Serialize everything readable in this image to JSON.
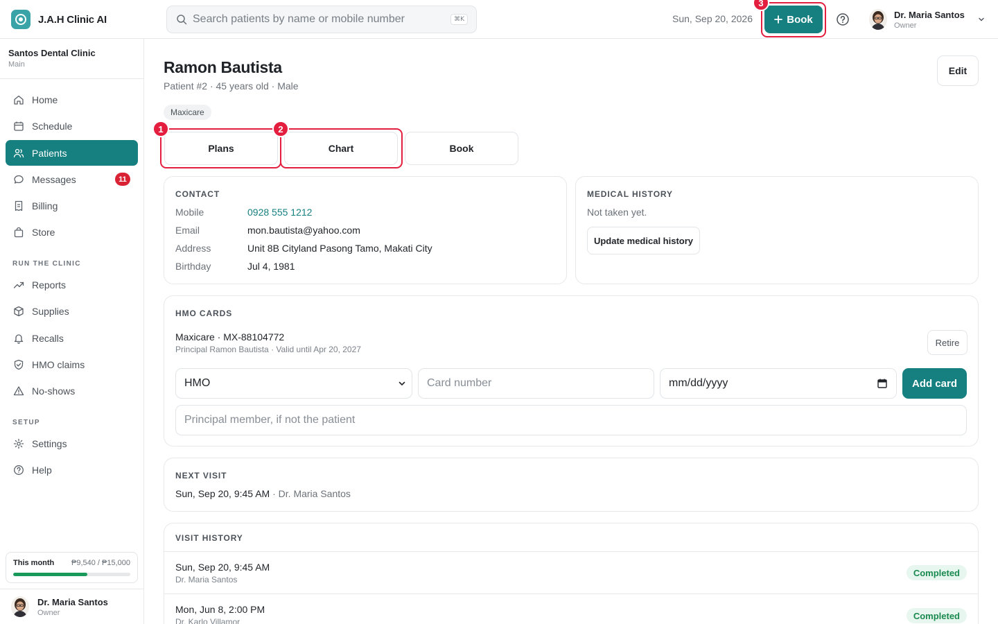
{
  "app": {
    "name": "J.A.H Clinic AI"
  },
  "search": {
    "placeholder": "Search patients by name or mobile number",
    "shortcut": "⌘K"
  },
  "top": {
    "date": "Sun, Sep 20, 2026",
    "book_label": "Book",
    "user": {
      "name": "Dr. Maria Santos",
      "role": "Owner"
    }
  },
  "annotations": {
    "one": "1",
    "two": "2",
    "three": "3"
  },
  "sidebar": {
    "clinic_name": "Santos Dental Clinic",
    "clinic_branch": "Main",
    "items": [
      {
        "label": "Home",
        "icon": "home-icon"
      },
      {
        "label": "Schedule",
        "icon": "calendar-icon"
      },
      {
        "label": "Patients",
        "icon": "users-icon",
        "active": true
      },
      {
        "label": "Messages",
        "icon": "message-icon",
        "badge": "11"
      },
      {
        "label": "Billing",
        "icon": "receipt-icon"
      },
      {
        "label": "Store",
        "icon": "bag-icon"
      }
    ],
    "section_run": "RUN THE CLINIC",
    "run_items": [
      {
        "label": "Reports",
        "icon": "trend-icon"
      },
      {
        "label": "Supplies",
        "icon": "box-icon"
      },
      {
        "label": "Recalls",
        "icon": "bell-icon"
      },
      {
        "label": "HMO claims",
        "icon": "shield-icon"
      },
      {
        "label": "No-shows",
        "icon": "warning-icon"
      }
    ],
    "section_setup": "SETUP",
    "setup_items": [
      {
        "label": "Settings",
        "icon": "gear-icon"
      },
      {
        "label": "Help",
        "icon": "help-icon"
      }
    ],
    "month": {
      "label": "This month",
      "value": "₱9,540 / ₱15,000",
      "progress": 0.636
    },
    "user": {
      "name": "Dr. Maria Santos",
      "role": "Owner"
    }
  },
  "patient": {
    "name": "Ramon Bautista",
    "sub": "Patient #2 · 45 years old · Male",
    "edit_label": "Edit",
    "tag": "Maxicare",
    "tabs": {
      "plans": "Plans",
      "chart": "Chart",
      "book": "Book"
    }
  },
  "contact": {
    "title": "CONTACT",
    "rows": [
      {
        "label": "Mobile",
        "value": "0928 555 1212"
      },
      {
        "label": "Email",
        "value": "mon.bautista@yahoo.com"
      },
      {
        "label": "Address",
        "value": "Unit 8B Cityland Pasong Tamo, Makati City"
      },
      {
        "label": "Birthday",
        "value": "Jul 4, 1981"
      }
    ]
  },
  "medical": {
    "title": "MEDICAL HISTORY",
    "status": "Not taken yet.",
    "button": "Update medical history"
  },
  "hmo": {
    "title": "HMO CARDS",
    "card_main": "Maxicare · MX-88104772",
    "card_sub": "Principal Ramon Bautista · Valid until Apr 20, 2027",
    "retire_label": "Retire",
    "form": {
      "type_value": "HMO",
      "card_placeholder": "Card number",
      "date_placeholder": "mm/dd/yyyy",
      "add_label": "Add card",
      "principal_placeholder": "Principal member, if not the patient"
    }
  },
  "next_visit": {
    "title": "NEXT VISIT",
    "when": "Sun, Sep 20, 9:45 AM",
    "who": " · Dr. Maria Santos"
  },
  "history": {
    "title": "VISIT HISTORY",
    "rows": [
      {
        "when": "Sun, Sep 20, 9:45 AM",
        "doctor": "Dr. Maria Santos",
        "status": "Completed"
      },
      {
        "when": "Mon, Jun 8, 2:00 PM",
        "doctor": "Dr. Karlo Villamor",
        "status": "Completed"
      }
    ]
  },
  "colors": {
    "accent": "#167f80",
    "highlight": "#e31e3f",
    "success": "#1a8a50"
  }
}
